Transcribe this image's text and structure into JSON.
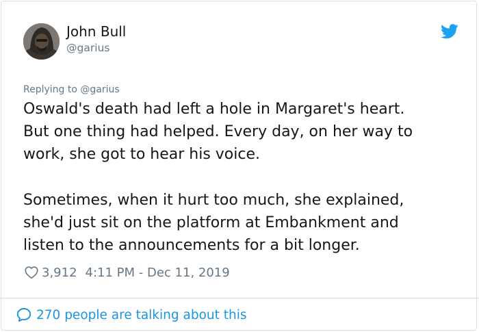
{
  "user": {
    "display_name": "John Bull",
    "handle": "@garius"
  },
  "reply_to": "Replying to @garius",
  "tweet": {
    "lines": [
      "Oswald's death had left a hole in Margaret's heart.",
      "But one thing had helped. Every day, on her way to",
      "work, she got to hear his voice.",
      "",
      "Sometimes, when it hurt too much, she explained,",
      "she'd just sit on the platform at Embankment and",
      "listen to the announcements for a bit longer."
    ]
  },
  "meta": {
    "likes": "3,912",
    "timestamp": "4:11 PM - Dec 11, 2019"
  },
  "footer": {
    "talking": "270 people are talking about this"
  },
  "icons": {
    "brand": "twitter-bird-icon",
    "like": "heart-icon",
    "conversation": "speech-bubble-icon"
  },
  "colors": {
    "text": "#14171a",
    "secondary": "#657786",
    "accent": "#1da1f2",
    "link": "#1b95e0",
    "border": "#d8dee3"
  }
}
